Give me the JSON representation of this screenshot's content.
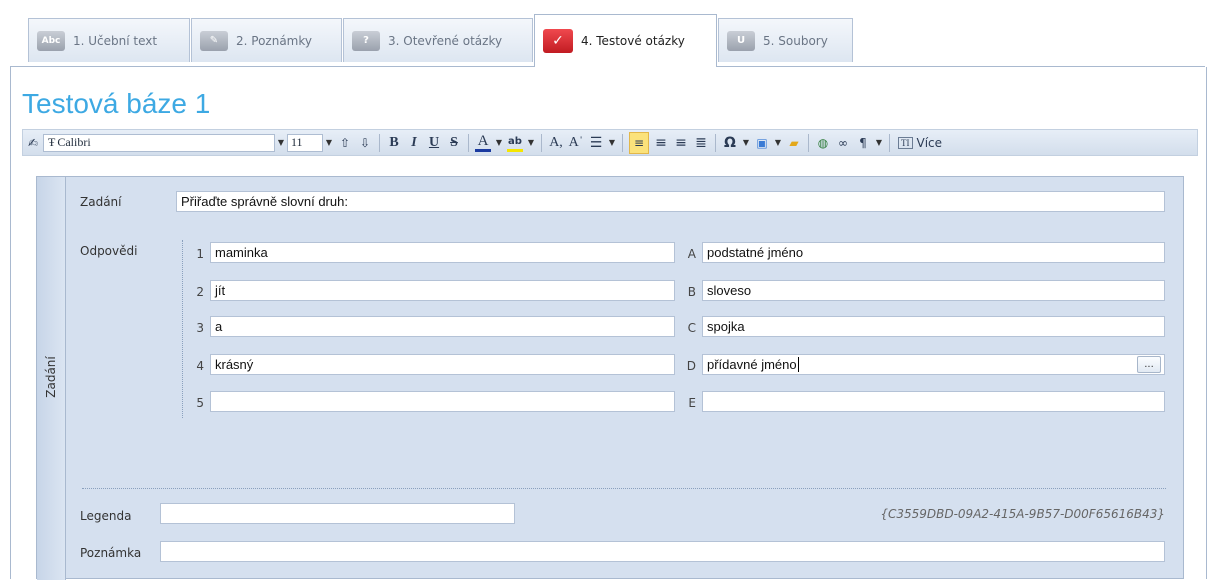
{
  "tabs": [
    {
      "icon": "abc-icon",
      "icon_text": "Abc",
      "label": "1. Učební text"
    },
    {
      "icon": "notes-icon",
      "icon_text": "\t",
      "label": "2. Poznámky"
    },
    {
      "icon": "question-icon",
      "icon_text": "?",
      "label": "3. Otevřené otázky"
    },
    {
      "icon": "check-icon",
      "icon_text": "✓",
      "label": "4. Testové otázky"
    },
    {
      "icon": "paperclip-icon",
      "icon_text": "U",
      "label": "5. Soubory"
    }
  ],
  "page_title": "Testová báze 1",
  "toolbar": {
    "font": "Calibri",
    "size": "11",
    "more_label": "Více"
  },
  "side_tab": "Zadání",
  "form": {
    "zadani_label": "Zadání",
    "zadani_value": "Přiřaďte správně slovní druh:",
    "answers_label": "Odpovědi",
    "left": [
      {
        "n": "1",
        "v": "maminka"
      },
      {
        "n": "2",
        "v": "jít"
      },
      {
        "n": "3",
        "v": "a"
      },
      {
        "n": "4",
        "v": "krásný"
      },
      {
        "n": "5",
        "v": ""
      }
    ],
    "right": [
      {
        "n": "A",
        "v": "podstatné jméno"
      },
      {
        "n": "B",
        "v": "sloveso"
      },
      {
        "n": "C",
        "v": "spojka"
      },
      {
        "n": "D",
        "v": "přídavné jméno"
      },
      {
        "n": "E",
        "v": ""
      }
    ],
    "legend_label": "Legenda",
    "legend_value": "",
    "note_label": "Poznámka",
    "note_value": "",
    "guid": "{C3559DBD-09A2-415A-9B57-D00F65616B43}",
    "ellipsis_label": "..."
  }
}
